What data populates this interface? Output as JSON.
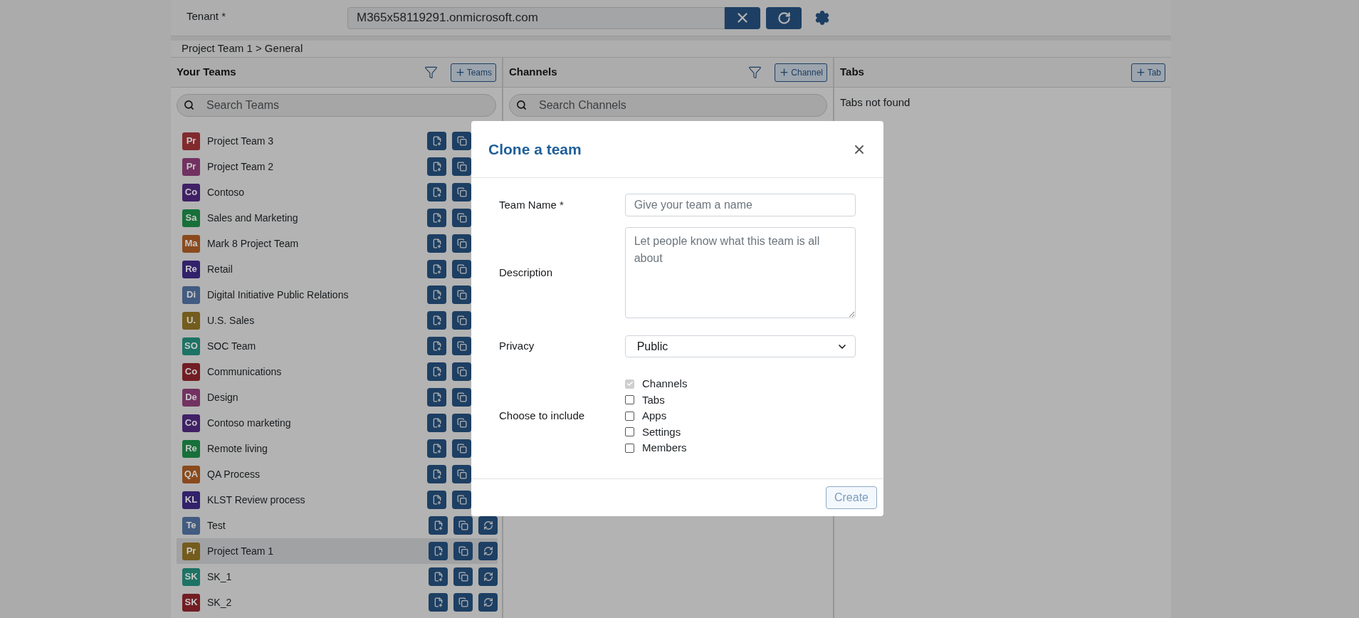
{
  "tenant": {
    "label": "Tenant *",
    "value": "M365x58119291.onmicrosoft.com"
  },
  "breadcrumb": "Project Team 1 > General",
  "teams_panel": {
    "title": "Your Teams",
    "add_button": "Teams",
    "search_placeholder": "Search Teams",
    "teams": [
      {
        "initials": "Pr",
        "name": "Project Team 3",
        "color": "#812a2e",
        "selected": false,
        "sync_button": false
      },
      {
        "initials": "Pr",
        "name": "Project Team 2",
        "color": "#723261",
        "selected": false,
        "sync_button": false
      },
      {
        "initials": "Co",
        "name": "Contoso",
        "color": "#402166",
        "selected": false,
        "sync_button": false
      },
      {
        "initials": "Sa",
        "name": "Sales and Marketing",
        "color": "#177039",
        "selected": false,
        "sync_button": false
      },
      {
        "initials": "Ma",
        "name": "Mark 8 Project Team",
        "color": "#8a4a1d",
        "selected": false,
        "sync_button": false
      },
      {
        "initials": "Re",
        "name": "Retail",
        "color": "#31226b",
        "selected": false,
        "sync_button": false
      },
      {
        "initials": "Di",
        "name": "Digital Initiative Public Relations",
        "color": "#425b81",
        "selected": false,
        "sync_button": false
      },
      {
        "initials": "U.",
        "name": "U.S. Sales",
        "color": "#735c1d",
        "selected": false,
        "sync_button": false
      },
      {
        "initials": "SO",
        "name": "SOC Team",
        "color": "#1d7364",
        "selected": false,
        "sync_button": false
      },
      {
        "initials": "Co",
        "name": "Communications",
        "color": "#721d23",
        "selected": false,
        "sync_button": false
      },
      {
        "initials": "De",
        "name": "Design",
        "color": "#723261",
        "selected": false,
        "sync_button": false
      },
      {
        "initials": "Co",
        "name": "Contoso marketing",
        "color": "#402166",
        "selected": false,
        "sync_button": false
      },
      {
        "initials": "Re",
        "name": "Remote living",
        "color": "#177039",
        "selected": false,
        "sync_button": false
      },
      {
        "initials": "QA",
        "name": "QA Process",
        "color": "#8a4a1d",
        "selected": false,
        "sync_button": false
      },
      {
        "initials": "KL",
        "name": "KLST Review process",
        "color": "#31226b",
        "selected": false,
        "sync_button": false
      },
      {
        "initials": "Te",
        "name": "Test",
        "color": "#425b81",
        "selected": false,
        "sync_button": true
      },
      {
        "initials": "Pr",
        "name": "Project Team 1",
        "color": "#735c1d",
        "selected": true,
        "sync_button": true
      },
      {
        "initials": "SK",
        "name": "SK_1",
        "color": "#1d7364",
        "selected": false,
        "sync_button": true
      },
      {
        "initials": "SK",
        "name": "SK_2",
        "color": "#721d23",
        "selected": false,
        "sync_button": true
      }
    ]
  },
  "channels_panel": {
    "title": "Channels",
    "add_button": "Channel",
    "search_placeholder": "Search Channels"
  },
  "tabs_panel": {
    "title": "Tabs",
    "add_button": "Tab",
    "empty_text": "Tabs not found"
  },
  "dialog": {
    "title": "Clone a team",
    "team_name": {
      "label": "Team Name *",
      "placeholder": "Give your team a name"
    },
    "description": {
      "label": "Description",
      "placeholder": "Let people know what this team is all about"
    },
    "privacy": {
      "label": "Privacy",
      "value": "Public"
    },
    "include": {
      "label": "Choose to include",
      "options": [
        {
          "label": "Channels",
          "checked": true,
          "disabled": true
        },
        {
          "label": "Tabs",
          "checked": false,
          "disabled": false
        },
        {
          "label": "Apps",
          "checked": false,
          "disabled": false
        },
        {
          "label": "Settings",
          "checked": false,
          "disabled": false
        },
        {
          "label": "Members",
          "checked": false,
          "disabled": false
        }
      ]
    },
    "create_button": {
      "label": "Create",
      "disabled": true
    }
  }
}
